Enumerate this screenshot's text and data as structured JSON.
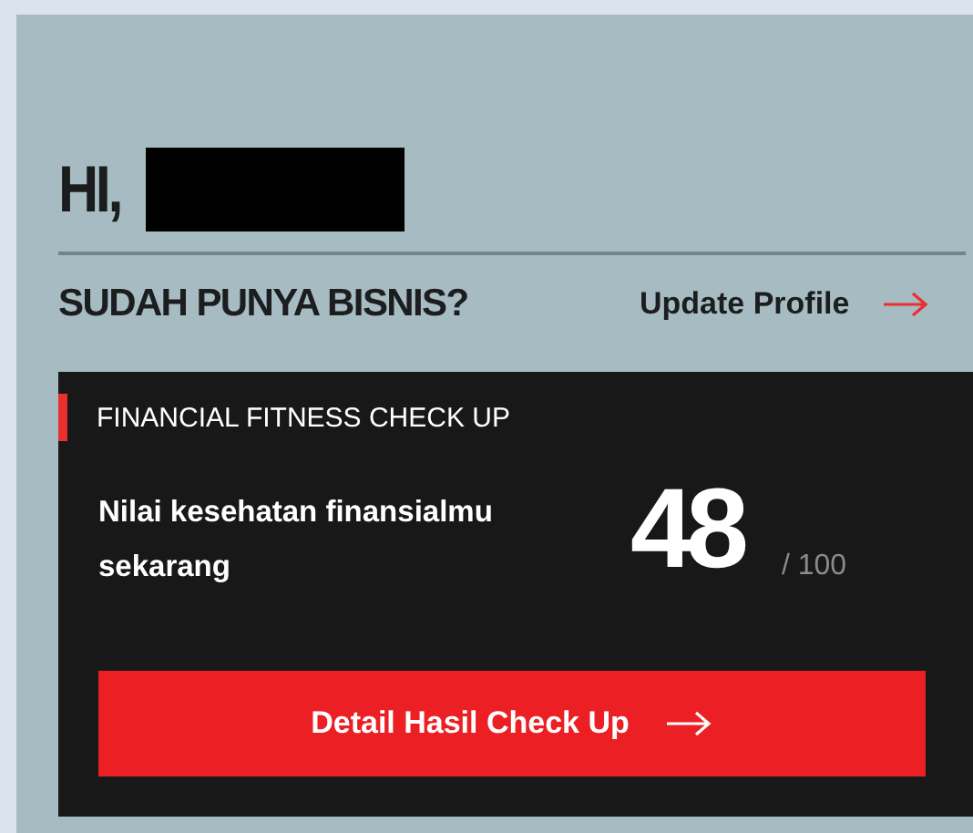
{
  "greeting": {
    "text": "HI,"
  },
  "business_prompt": {
    "question": "SUDAH PUNYA BISNIS?",
    "link": "Update Profile"
  },
  "fitness_card": {
    "title": "FINANCIAL FITNESS CHECK UP",
    "description": "Nilai kesehatan finansialmu sekarang",
    "score": "48",
    "max": "/ 100",
    "button": "Detail Hasil Check Up"
  }
}
